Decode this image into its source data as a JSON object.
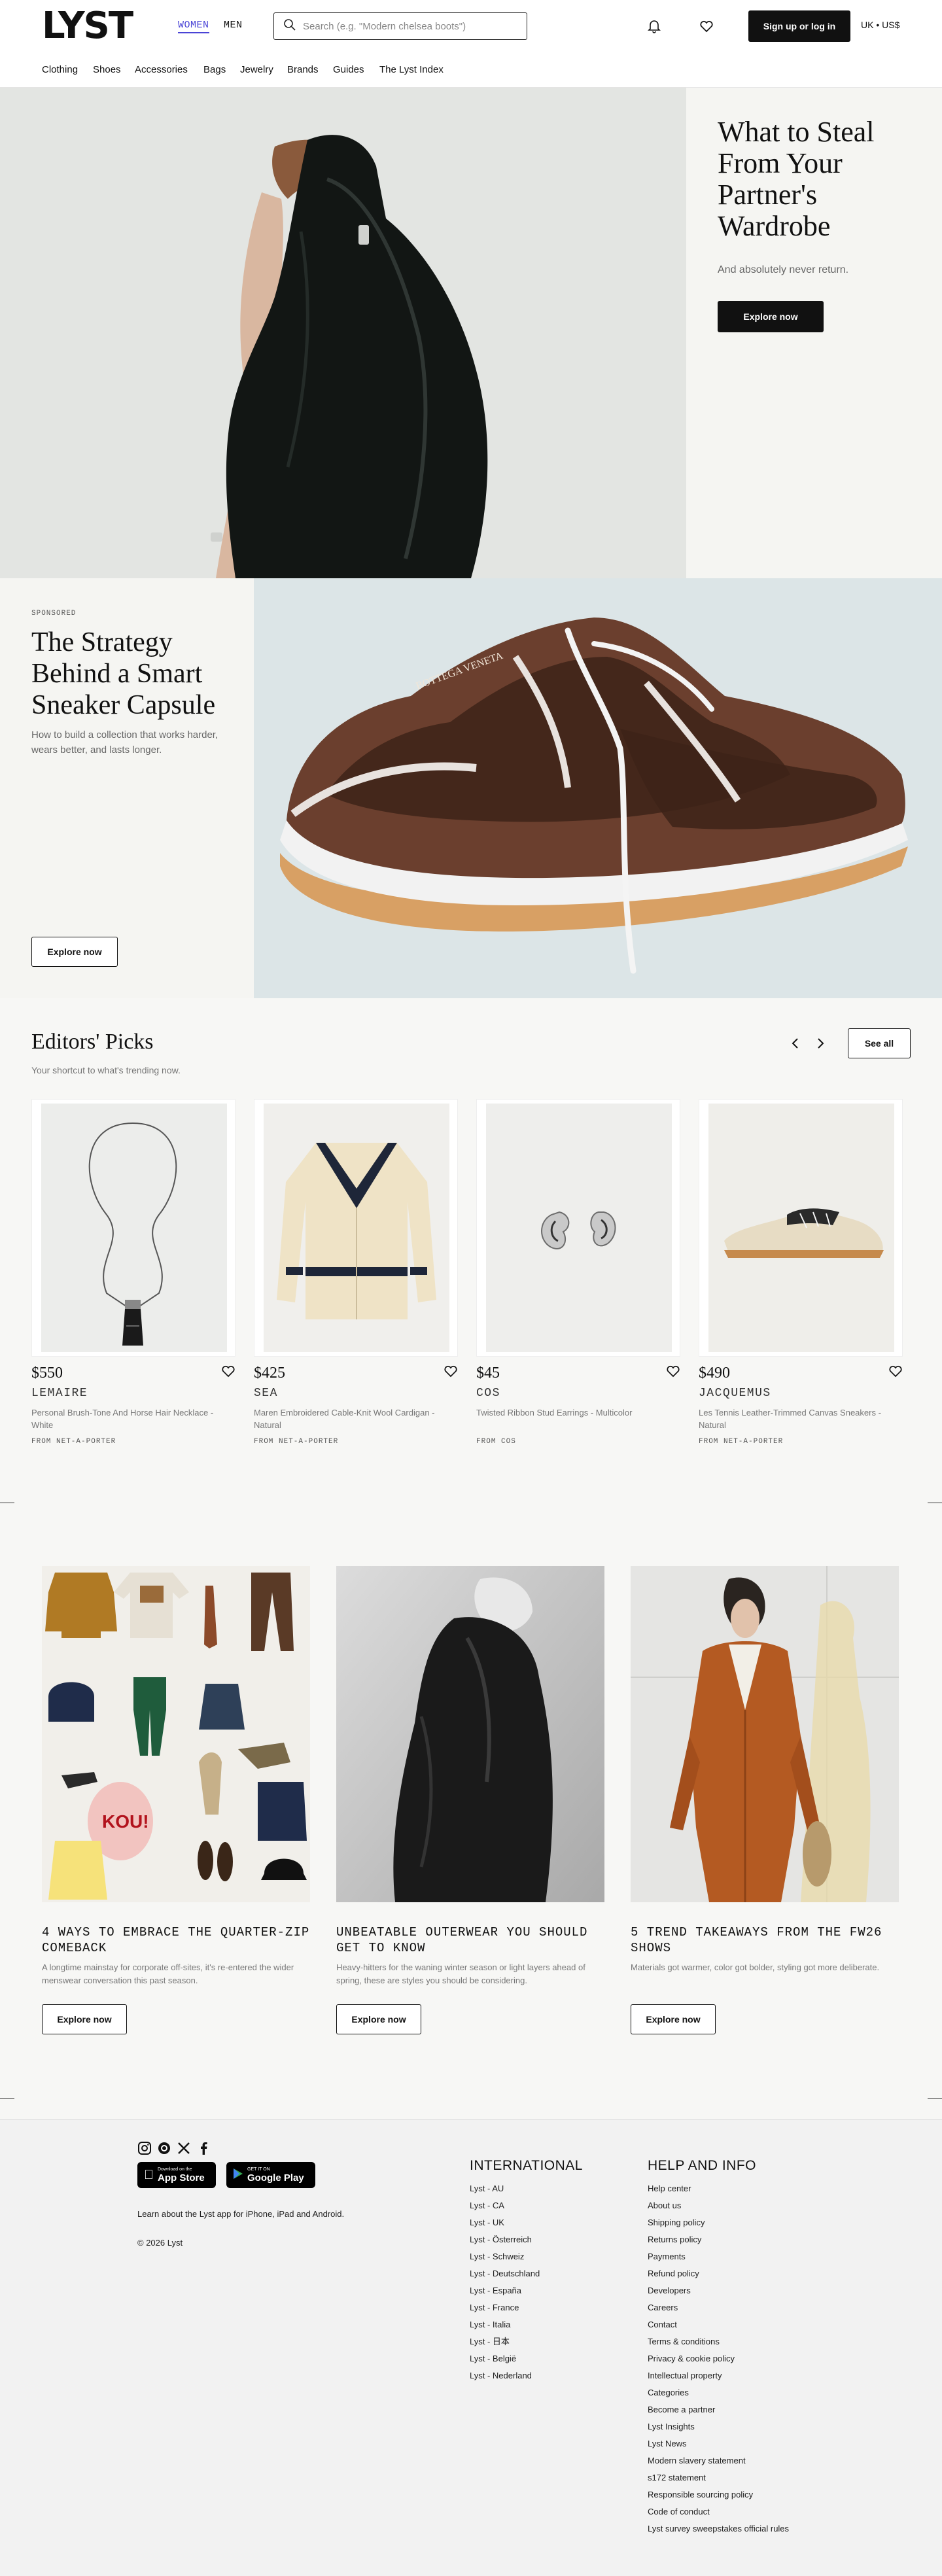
{
  "header": {
    "logo": "LYST",
    "gender_women": "WOMEN",
    "gender_men": "MEN",
    "search_placeholder": "Search (e.g. \"Modern chelsea boots\")",
    "signup_label": "Sign up or log in",
    "currency": "UK • US$",
    "icons": [
      "search-icon",
      "bell-icon",
      "heart-icon"
    ]
  },
  "nav": [
    "Clothing",
    "Shoes",
    "Accessories",
    "Bags",
    "Jewelry",
    "Brands",
    "Guides",
    "The Lyst Index"
  ],
  "hero1": {
    "title": "What to Steal From Your Partner's Wardrobe",
    "subtitle": "And absolutely never return.",
    "cta": "Explore now"
  },
  "hero2": {
    "sponsored": "SPONSORED",
    "title": "The Strategy Behind a Smart Sneaker Capsule",
    "subtitle": "How to build a collection that works harder, wears better, and lasts longer.",
    "cta": "Explore now",
    "shoe_text": "BOTTEGA VENETA"
  },
  "editors_picks": {
    "title": "Editors' Picks",
    "subtitle": "Your shortcut to what's trending now.",
    "see_all": "See all",
    "products": [
      {
        "price": "$550",
        "brand": "LEMAIRE",
        "name": "Personal Brush-Tone And Horse Hair Necklace - White",
        "from": "FROM NET-A-PORTER"
      },
      {
        "price": "$425",
        "brand": "SEA",
        "name": "Maren Embroidered Cable-Knit Wool Cardigan - Natural",
        "from": "FROM NET-A-PORTER"
      },
      {
        "price": "$45",
        "brand": "COS",
        "name": "Twisted Ribbon Stud Earrings - Multicolor",
        "from": "FROM COS"
      },
      {
        "price": "$490",
        "brand": "JACQUEMUS",
        "name": "Les Tennis Leather-Trimmed Canvas Sneakers - Natural",
        "from": "FROM NET-A-PORTER"
      }
    ]
  },
  "editorial": [
    {
      "title": "4 WAYS TO EMBRACE THE QUARTER-ZIP COMEBACK",
      "desc": "A longtime mainstay for corporate off-sites, it's re-entered the wider menswear conversation this past season.",
      "cta": "Explore now",
      "tote_text": "KOU!"
    },
    {
      "title": "UNBEATABLE OUTERWEAR YOU SHOULD GET TO KNOW",
      "desc": "Heavy-hitters for the waning winter season or light layers ahead of spring, these are styles you should be considering.",
      "cta": "Explore now"
    },
    {
      "title": "5 TREND TAKEAWAYS FROM THE FW26 SHOWS",
      "desc": "Materials got warmer, color got bolder, styling got more deliberate.",
      "cta": "Explore now"
    }
  ],
  "footer": {
    "social_icons": [
      "instagram-icon",
      "threads-icon",
      "x-icon",
      "facebook-icon"
    ],
    "app_store_small": "Download on the",
    "app_store": "App Store",
    "google_play_small": "GET IT ON",
    "google_play": "Google Play",
    "app_text": "Learn about the Lyst app for iPhone, iPad and Android.",
    "copyright": "© 2026 Lyst",
    "international_title": "INTERNATIONAL",
    "international": [
      "Lyst - AU",
      "Lyst - CA",
      "Lyst - UK",
      "Lyst - Österreich",
      "Lyst - Schweiz",
      "Lyst - Deutschland",
      "Lyst - España",
      "Lyst - France",
      "Lyst - Italia",
      "Lyst - 日本",
      "Lyst - België",
      "Lyst - Nederland"
    ],
    "help_title": "HELP AND INFO",
    "help": [
      "Help center",
      "About us",
      "Shipping policy",
      "Returns policy",
      "Payments",
      "Refund policy",
      "Developers",
      "Careers",
      "Contact",
      "Terms & conditions",
      "Privacy & cookie policy",
      "Intellectual property",
      "Categories",
      "Become a partner",
      "Lyst Insights",
      "Lyst News",
      "Modern slavery statement",
      "s172 statement",
      "Responsible sourcing policy",
      "Code of conduct",
      "Lyst survey sweepstakes official rules"
    ]
  },
  "colors": {
    "accent": "#4a44d6",
    "dark": "#111111",
    "background": "#f7f7f5"
  }
}
